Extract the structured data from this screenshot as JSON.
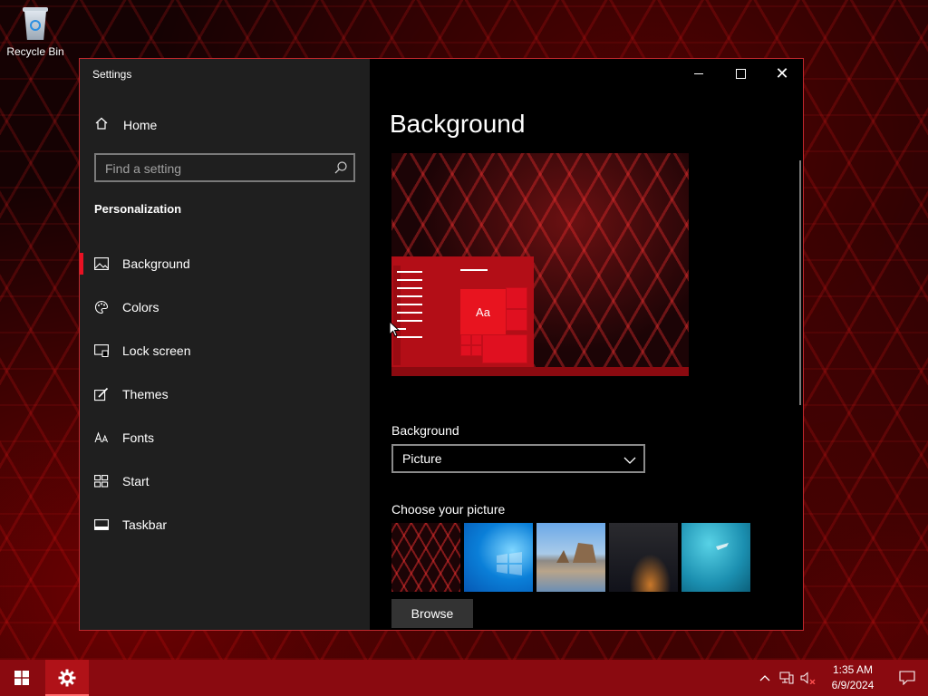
{
  "desktop": {
    "icons": [
      {
        "label": "Recycle Bin",
        "icon": "recycle-bin-icon"
      }
    ]
  },
  "window": {
    "title": "Settings",
    "controls": [
      "minimize",
      "maximize",
      "close"
    ]
  },
  "sidebar": {
    "home_label": "Home",
    "search_placeholder": "Find a setting",
    "section_title": "Personalization",
    "items": [
      {
        "label": "Background",
        "icon": "picture-icon",
        "active": true
      },
      {
        "label": "Colors",
        "icon": "palette-icon",
        "active": false
      },
      {
        "label": "Lock screen",
        "icon": "lock-screen-icon",
        "active": false
      },
      {
        "label": "Themes",
        "icon": "themes-icon",
        "active": false
      },
      {
        "label": "Fonts",
        "icon": "fonts-icon",
        "active": false
      },
      {
        "label": "Start",
        "icon": "start-icon",
        "active": false
      },
      {
        "label": "Taskbar",
        "icon": "taskbar-icon",
        "active": false
      }
    ]
  },
  "content": {
    "title": "Background",
    "preview_sample_text": "Aa",
    "background_label": "Background",
    "background_value": "Picture",
    "choose_label": "Choose your picture",
    "browse_label": "Browse"
  },
  "taskbar": {
    "time": "1:35 AM",
    "date": "6/9/2024"
  },
  "colors": {
    "accent": "#e81123",
    "taskbar": "#8a0a10",
    "window_border": "#c0282d"
  }
}
